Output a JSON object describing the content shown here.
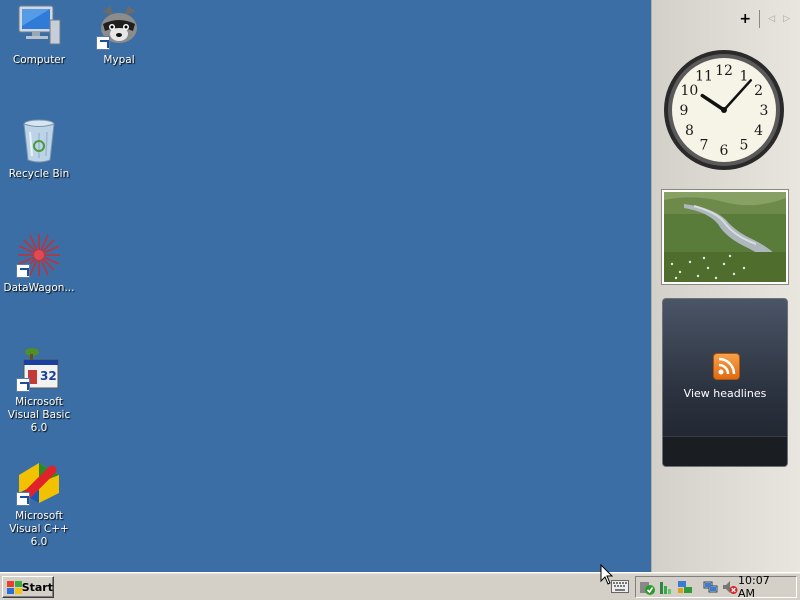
{
  "desktop": {
    "icons": [
      {
        "label": "Computer",
        "icon": "computer-icon"
      },
      {
        "label": "Mypal",
        "icon": "raccoon-icon",
        "shortcut": true
      },
      {
        "label": "Recycle Bin",
        "icon": "recycle-bin-icon"
      },
      {
        "label": "DataWagon...",
        "icon": "datawagon-icon",
        "shortcut": true
      },
      {
        "label": "Microsoft Visual Basic 6.0",
        "icon": "vb6-icon",
        "shortcut": true
      },
      {
        "label": "Microsoft Visual C++ 6.0",
        "icon": "vc6-icon",
        "shortcut": true
      }
    ],
    "background_color": "#3a6ea5"
  },
  "sidebar": {
    "add_label": "+",
    "prev_label": "◁",
    "next_label": "▷",
    "clock": {
      "numbers": [
        "12",
        "1",
        "2",
        "3",
        "4",
        "5",
        "6",
        "7",
        "8",
        "9",
        "10",
        "11"
      ],
      "hour": 10,
      "minute": 7
    },
    "feed": {
      "label": "View headlines"
    }
  },
  "taskbar": {
    "start_label": "Start",
    "time": "10:07 AM",
    "tray_icons": [
      "shield-icon",
      "network-icon",
      "updates-icon",
      "network-connection-icon",
      "volume-muted-icon"
    ]
  }
}
